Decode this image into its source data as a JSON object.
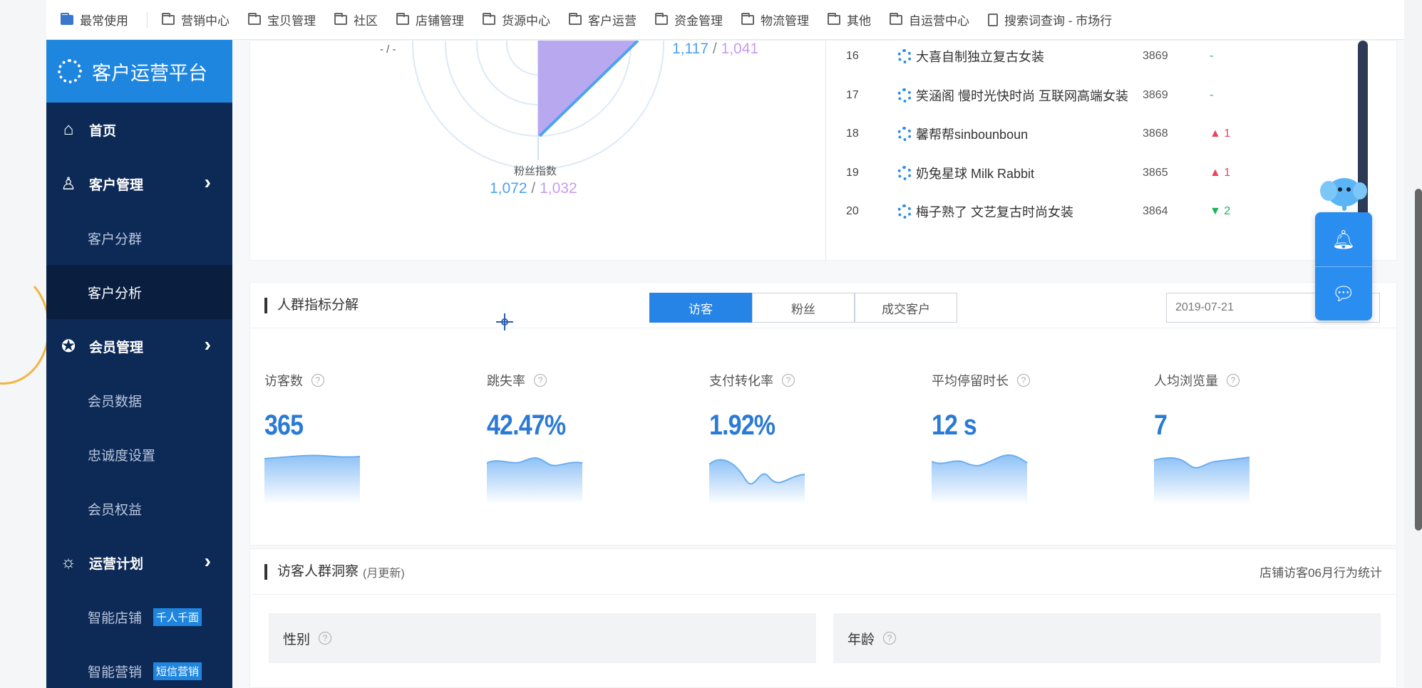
{
  "bookmarks": [
    {
      "label": "最常使用",
      "icon": "bookmark-folder-icon"
    },
    {
      "label": "营销中心",
      "icon": "folder-icon"
    },
    {
      "label": "宝贝管理",
      "icon": "folder-icon"
    },
    {
      "label": "社区",
      "icon": "folder-icon"
    },
    {
      "label": "店铺管理",
      "icon": "folder-icon"
    },
    {
      "label": "货源中心",
      "icon": "folder-icon"
    },
    {
      "label": "客户运营",
      "icon": "folder-icon"
    },
    {
      "label": "资金管理",
      "icon": "folder-icon"
    },
    {
      "label": "物流管理",
      "icon": "folder-icon"
    },
    {
      "label": "其他",
      "icon": "folder-icon"
    },
    {
      "label": "自运营中心",
      "icon": "folder-icon"
    },
    {
      "label": "搜索词查询 - 市场行",
      "icon": "page-icon"
    }
  ],
  "sidebar": {
    "brand": "客户运营平台",
    "items": [
      {
        "label": "首页",
        "type": "top",
        "icon": "home-icon"
      },
      {
        "label": "客户管理",
        "type": "top",
        "icon": "user-icon",
        "chevron": true
      },
      {
        "label": "客户分群",
        "type": "sub"
      },
      {
        "label": "客户分析",
        "type": "sub",
        "active": true
      },
      {
        "label": "会员管理",
        "type": "top",
        "icon": "star-badge-icon",
        "chevron": true
      },
      {
        "label": "会员数据",
        "type": "sub"
      },
      {
        "label": "忠诚度设置",
        "type": "sub"
      },
      {
        "label": "会员权益",
        "type": "sub"
      },
      {
        "label": "运营计划",
        "type": "top",
        "icon": "lightbulb-icon",
        "chevron": true
      },
      {
        "label": "智能店铺",
        "type": "sub",
        "tag": "千人千面"
      },
      {
        "label": "智能营销",
        "type": "sub",
        "tag": "短信营销"
      }
    ]
  },
  "radar": {
    "top_left": "- / -",
    "top_right": {
      "a": "1,117",
      "b": "1,041"
    },
    "bottom_label": "粉丝指数",
    "bottom": {
      "a": "1,072",
      "b": "1,032"
    }
  },
  "ranking": [
    {
      "no": "16",
      "name": "大喜自制独立复古女装",
      "score": "3869",
      "change": "-",
      "dir": "flat"
    },
    {
      "no": "17",
      "name": "笑涵阁 慢时光快时尚 互联网高端女装",
      "score": "3869",
      "change": "-",
      "dir": "flat"
    },
    {
      "no": "18",
      "name": "馨帮帮sinbounboun",
      "score": "3868",
      "change": "▲ 1",
      "dir": "up"
    },
    {
      "no": "19",
      "name": "奶兔星球 Milk Rabbit",
      "score": "3865",
      "change": "▲ 1",
      "dir": "up"
    },
    {
      "no": "20",
      "name": "梅子熟了 文艺复古时尚女装",
      "score": "3864",
      "change": "▼ 2",
      "dir": "down"
    }
  ],
  "crowd": {
    "title": "人群指标分解",
    "tabs": [
      "访客",
      "粉丝",
      "成交客户"
    ],
    "date": "2019-07-21",
    "metrics": [
      {
        "label": "访客数",
        "value": "365"
      },
      {
        "label": "跳失率",
        "value": "42.47%"
      },
      {
        "label": "支付转化率",
        "value": "1.92%"
      },
      {
        "label": "平均停留时长",
        "value": "12 s"
      },
      {
        "label": "人均浏览量",
        "value": "7"
      }
    ]
  },
  "insight": {
    "title": "访客人群洞察",
    "sub": "(月更新)",
    "right": "店铺访客06月行为统计",
    "panels": [
      "性别",
      "年龄"
    ]
  },
  "floating": {
    "bell": "bell-icon",
    "chat": "chat-icon"
  },
  "colors": {
    "accent": "#2584e6",
    "sidebar": "#0d2a57",
    "up": "#e8455a",
    "down": "#1bb25c"
  }
}
